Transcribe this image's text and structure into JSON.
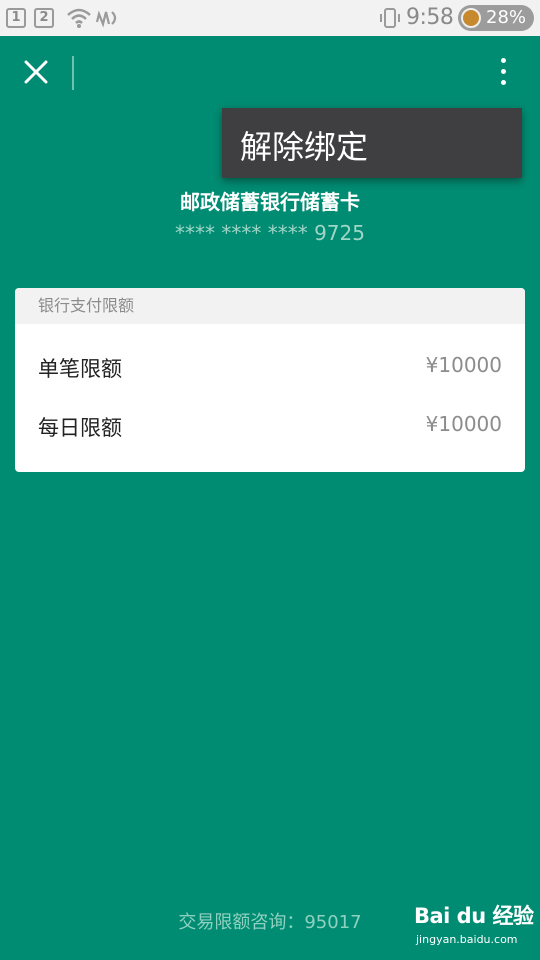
{
  "status_bar": {
    "sim1": "1",
    "sim2": "2",
    "time": "9:58",
    "battery": "28%",
    "icons": [
      "sim1-icon",
      "sim2-icon",
      "wifi-icon",
      "signal-icon",
      "vibrate-icon",
      "battery-icon"
    ]
  },
  "toolbar": {
    "close_icon": "close-icon",
    "more_icon": "more-vertical-icon"
  },
  "popup_menu": {
    "items": [
      {
        "label": "解除绑定"
      }
    ]
  },
  "card": {
    "bank_name": "邮政储蓄银行储蓄卡",
    "number": "**** **** **** 9725"
  },
  "limits": {
    "header": "银行支付限额",
    "rows": [
      {
        "label": "单笔限额",
        "value": "¥10000"
      },
      {
        "label": "每日限额",
        "value": "¥10000"
      }
    ]
  },
  "footer": {
    "text": "交易限额咨询：95017"
  },
  "watermark": {
    "brand": "Bai du 经验",
    "url": "jingyan.baidu.com"
  },
  "colors": {
    "background": "#008c72",
    "popup": "#3f3f42",
    "status_bar": "#f2f2f2"
  }
}
